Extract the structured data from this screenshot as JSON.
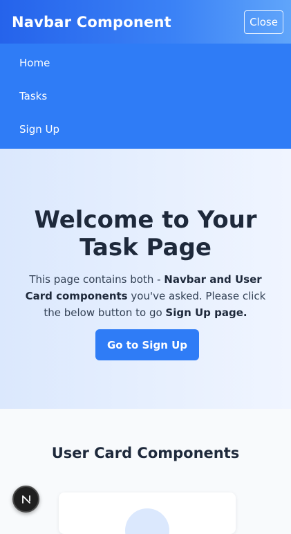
{
  "header": {
    "brand": "Navbar Component",
    "close_label": "Close"
  },
  "menu": {
    "items": [
      {
        "label": "Home"
      },
      {
        "label": "Tasks"
      },
      {
        "label": "Sign Up"
      }
    ]
  },
  "hero": {
    "title": "Welcome to Your Task Page",
    "text_1": "This page contains both - ",
    "text_bold_1": "Navbar and User Card components",
    "text_2": " you've asked. Please click the below button to go ",
    "text_bold_2": "Sign Up page.",
    "cta_label": "Go to Sign Up"
  },
  "cards": {
    "title": "User Card Components"
  },
  "fab": {
    "icon": "nextjs-logo-icon",
    "letter": "N"
  },
  "colors": {
    "primary": "#2f7cf6",
    "header_gradient_start": "#2563eb",
    "header_gradient_end": "#60a5fa",
    "hero_bg": "#dbe8fd",
    "text_dark": "#1e293b"
  }
}
